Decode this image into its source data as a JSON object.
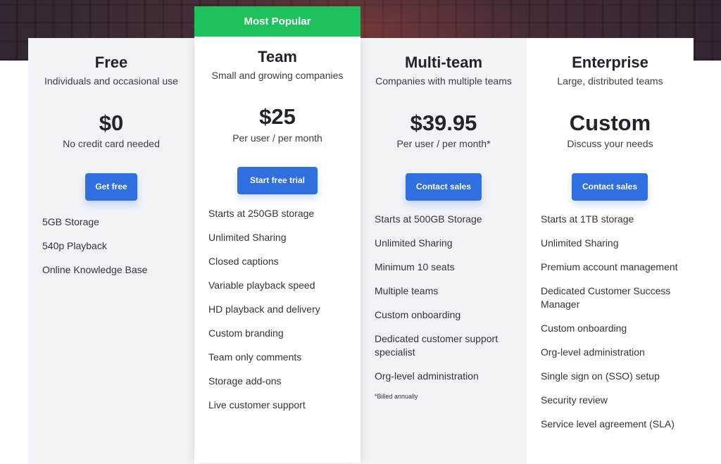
{
  "popular_badge": "Most Popular",
  "plans": [
    {
      "name": "Free",
      "subtitle": "Individuals and occasional use",
      "price": "$0",
      "price_note": "No credit card needed",
      "cta": "Get free",
      "features": [
        "5GB Storage",
        "540p Playback",
        "Online Knowledge Base"
      ]
    },
    {
      "name": "Team",
      "subtitle": "Small and growing companies",
      "price": "$25",
      "price_note": "Per user / per month",
      "cta": "Start free trial",
      "features": [
        "Starts at 250GB storage",
        "Unlimited Sharing",
        "Closed captions",
        "Variable playback speed",
        "HD playback and delivery",
        "Custom branding",
        "Team only comments",
        "Storage add-ons",
        "Live customer support"
      ]
    },
    {
      "name": "Multi-team",
      "subtitle": "Companies with multiple teams",
      "price": "$39.95",
      "price_note": "Per user / per month*",
      "cta": "Contact sales",
      "features": [
        "Starts at 500GB Storage",
        "Unlimited Sharing",
        "Minimum 10 seats",
        "Multiple teams",
        "Custom onboarding",
        "Dedicated customer support specialist",
        "Org-level administration"
      ],
      "footnote": "*Billed annually"
    },
    {
      "name": "Enterprise",
      "subtitle": "Large, distributed teams",
      "price": "Custom",
      "price_note": "Discuss your needs",
      "cta": "Contact sales",
      "features": [
        "Starts at 1TB storage",
        "Unlimited Sharing",
        "Premium account management",
        "Dedicated Customer Success Manager",
        "Custom onboarding",
        "Org-level administration",
        "Single sign on (SSO) setup",
        "Security review",
        "Service level agreement (SLA)"
      ]
    }
  ],
  "colors": {
    "accent_blue": "#2f6fdf",
    "popular_green": "#1ec15c",
    "panel_gray": "#f1f3f6",
    "hero_dark": "#3a2530"
  }
}
